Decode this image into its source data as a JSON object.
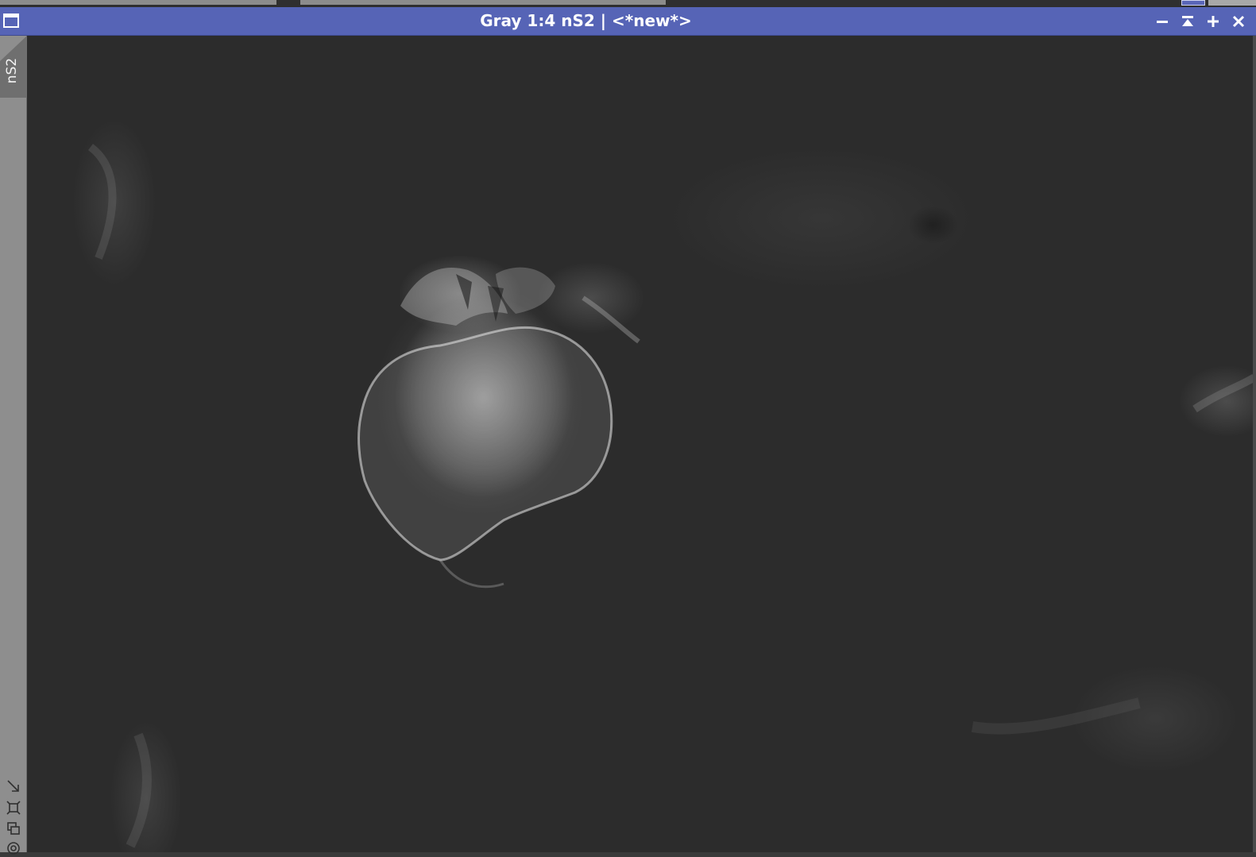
{
  "window": {
    "title": "Gray 1:4 nS2 | <*new*>",
    "identifier": "nS2",
    "title_bar_color": "#5664b6"
  },
  "title_buttons": [
    "minimize-icon",
    "shade-icon",
    "maximize-icon",
    "close-icon"
  ],
  "side_tools": [
    "auto-fit-icon",
    "zoom-to-fit-icon",
    "clone-view-icon",
    "view-target-icon"
  ]
}
